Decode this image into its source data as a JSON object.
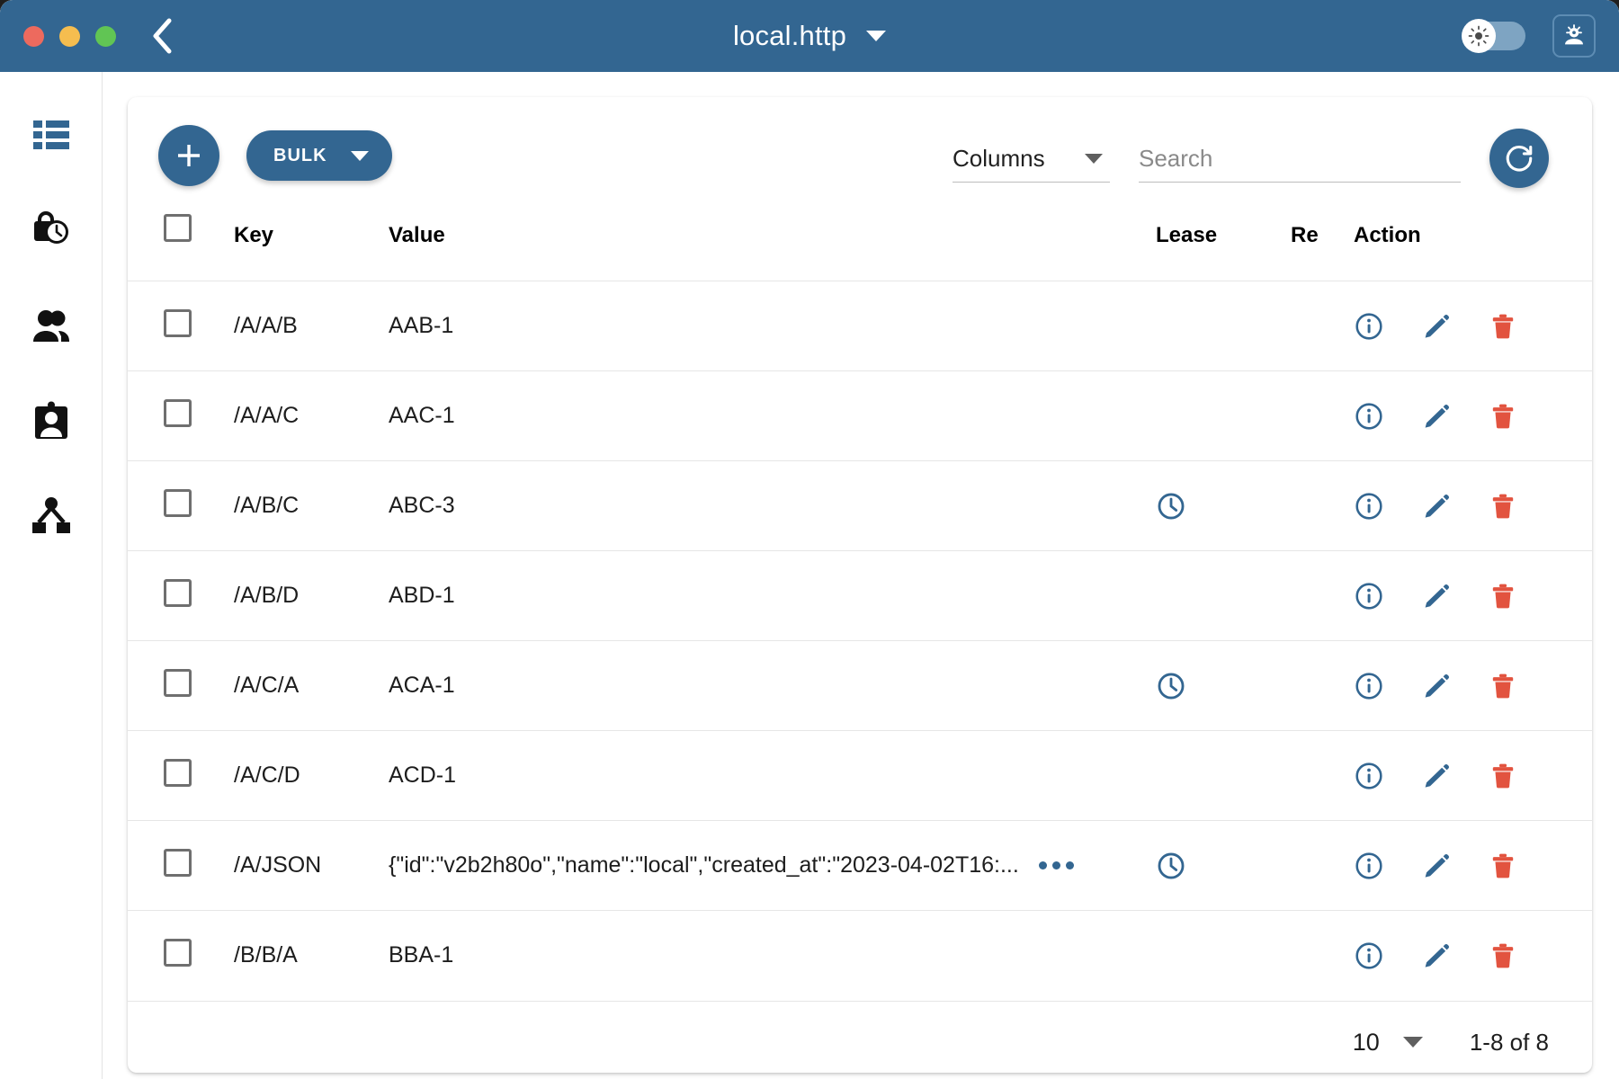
{
  "titlebar": {
    "title": "local.http",
    "title_caret_icon": "chevron-down-icon",
    "back_icon": "chevron-left-icon",
    "traffic_lights": [
      "close",
      "minimize",
      "maximize"
    ],
    "theme_toggle_icon": "sun-icon",
    "avatar_icon": "user-avatar-icon"
  },
  "sidebar": {
    "items": [
      {
        "icon": "list-view-icon",
        "active": true
      },
      {
        "icon": "lock-clock-icon",
        "active": false
      },
      {
        "icon": "people-icon",
        "active": false
      },
      {
        "icon": "id-badge-icon",
        "active": false
      },
      {
        "icon": "cluster-node-icon",
        "active": false
      }
    ]
  },
  "toolbar": {
    "add_label": "+",
    "add_icon": "plus-icon",
    "bulk_label": "BULK",
    "bulk_caret_icon": "caret-down-icon",
    "columns_label": "Columns",
    "columns_caret_icon": "caret-down-icon",
    "search_placeholder": "Search",
    "search_value": "",
    "refresh_icon": "refresh-icon"
  },
  "table": {
    "headers": {
      "key": "Key",
      "value": "Value",
      "lease": "Lease",
      "re": "Re",
      "action": "Action"
    },
    "select_all_checked": false,
    "rows": [
      {
        "key": "/A/A/B",
        "value": "AAB-1",
        "lease": false,
        "truncated": false
      },
      {
        "key": "/A/A/C",
        "value": "AAC-1",
        "lease": false,
        "truncated": false
      },
      {
        "key": "/A/B/C",
        "value": "ABC-3",
        "lease": true,
        "truncated": false
      },
      {
        "key": "/A/B/D",
        "value": "ABD-1",
        "lease": false,
        "truncated": false
      },
      {
        "key": "/A/C/A",
        "value": "ACA-1",
        "lease": true,
        "truncated": false
      },
      {
        "key": "/A/C/D",
        "value": "ACD-1",
        "lease": false,
        "truncated": false
      },
      {
        "key": "/A/JSON",
        "value": "{\"id\":\"v2b2h80o\",\"name\":\"local\",\"created_at\":\"2023-04-02T16:...",
        "lease": true,
        "truncated": true
      },
      {
        "key": "/B/B/A",
        "value": "BBA-1",
        "lease": false,
        "truncated": false
      }
    ],
    "row_actions": {
      "info_icon": "info-circle-icon",
      "edit_icon": "pencil-icon",
      "delete_icon": "trash-icon"
    },
    "lease_icon": "clock-icon",
    "more_icon": "ellipsis-icon"
  },
  "footer": {
    "rows_per_page": "10",
    "rows_caret_icon": "caret-down-icon",
    "range": "1-8 of 8"
  },
  "colors": {
    "header_blue": "#336691",
    "accent_blue": "#336691",
    "delete_red": "#e2533f",
    "traffic_red": "#ed6a5e",
    "traffic_yellow": "#f5bd4f",
    "traffic_green": "#61c554"
  }
}
